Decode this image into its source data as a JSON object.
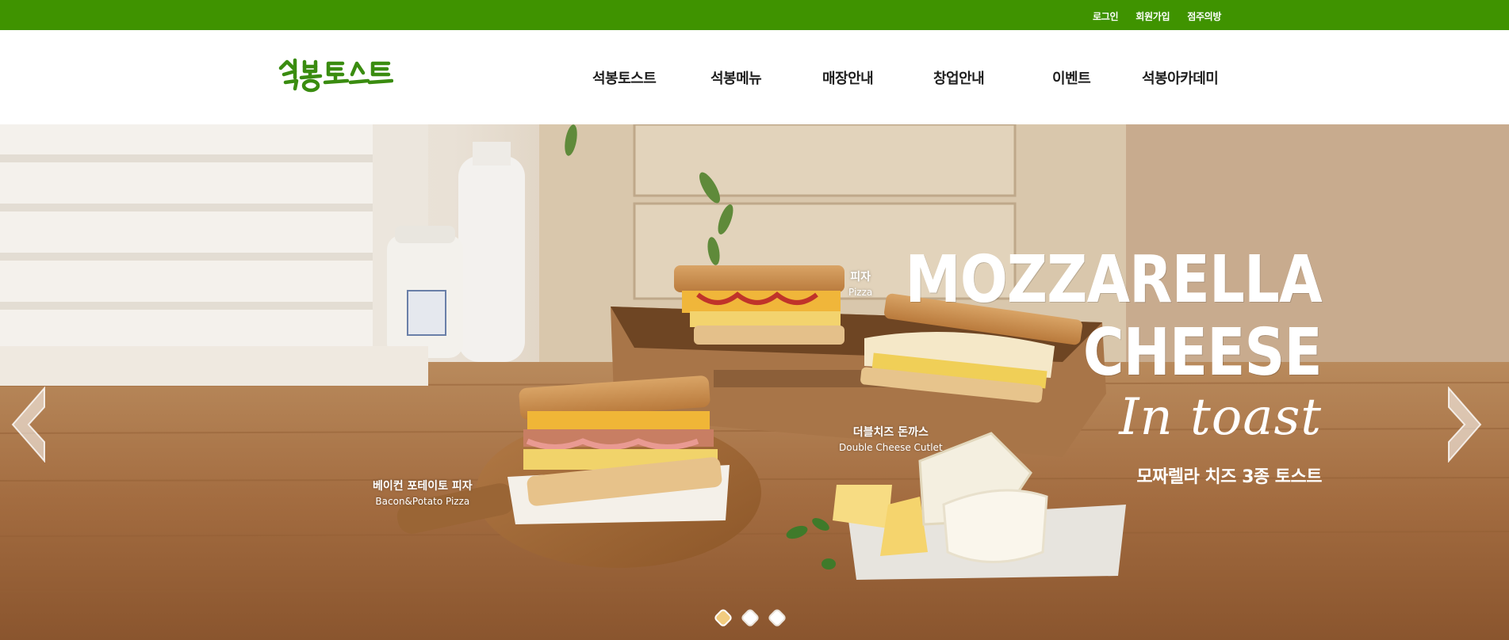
{
  "topbar": {
    "links": [
      "로그인",
      "회원가입",
      "점주의방"
    ],
    "background": "#3f9300"
  },
  "header": {
    "logo_text": "석봉토스트",
    "logo_color": "#3a8c10",
    "nav": [
      "석봉토스트",
      "석봉메뉴",
      "매장안내",
      "창업안내",
      "이벤트",
      "석봉아카데미"
    ]
  },
  "hero": {
    "title_line1": "MOZZARELLA",
    "title_line2": "CHEESE",
    "title_line3": "In toast",
    "subtitle": "모짜렐라 치즈 3종 토스트",
    "menu_items": [
      {
        "ko": "피자",
        "en": "Pizza"
      },
      {
        "ko": "더블치즈 돈까스",
        "en": "Double Cheese Cutlet"
      },
      {
        "ko": "베이컨 포테이토 피자",
        "en": "Bacon&Potato Pizza"
      }
    ],
    "prev_icon": "chevron-left-icon",
    "next_icon": "chevron-right-icon",
    "slide_count": 3,
    "active_slide": 1,
    "active_dot_color": "#f2cc7f"
  }
}
